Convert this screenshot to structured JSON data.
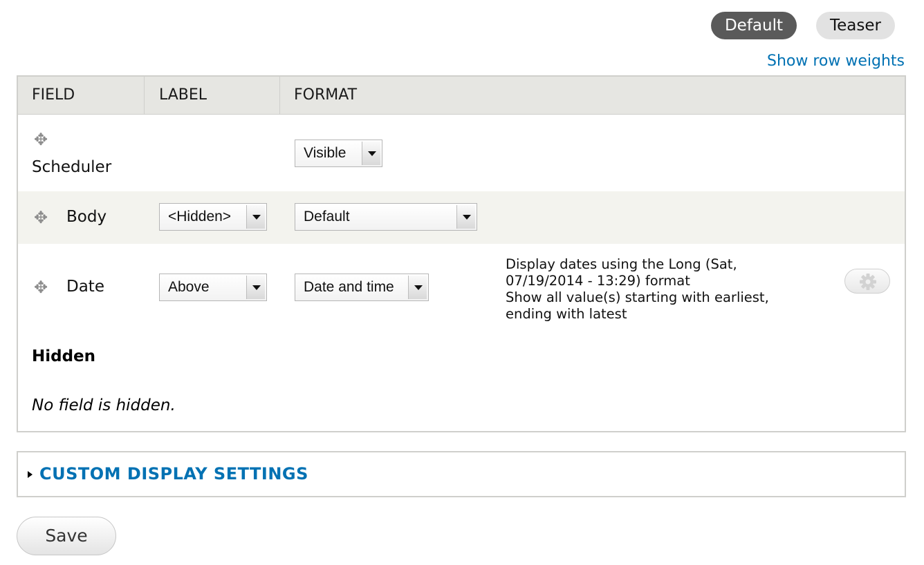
{
  "tabs": [
    {
      "label": "Default",
      "active": true
    },
    {
      "label": "Teaser",
      "active": false
    }
  ],
  "show_row_weights": "Show row weights",
  "table": {
    "headers": [
      "FIELD",
      "LABEL",
      "FORMAT"
    ],
    "rows": [
      {
        "field": "Scheduler",
        "label": "",
        "format": "Visible",
        "summary": []
      },
      {
        "field": "Body",
        "label": "<Hidden>",
        "format": "Default",
        "summary": []
      },
      {
        "field": "Date",
        "label": "Above",
        "format": "Date and time",
        "summary": [
          "Display dates using the Long (Sat,",
          "07/19/2014 - 13:29) format",
          "Show all value(s) starting with earliest,",
          "ending with latest"
        ]
      }
    ],
    "hidden_title": "Hidden",
    "hidden_empty": "No field is hidden."
  },
  "custom_display_settings": "CUSTOM DISPLAY SETTINGS",
  "save_label": "Save",
  "icons": {
    "drag": "drag-handle-icon",
    "settings": "gear-icon",
    "disclosure": "triangle-right-icon"
  },
  "colors": {
    "link": "#0071b3",
    "active_tab": "#5a5a5a",
    "header_bg": "#e6e6e2",
    "alt_row_bg": "#f3f3ee"
  }
}
